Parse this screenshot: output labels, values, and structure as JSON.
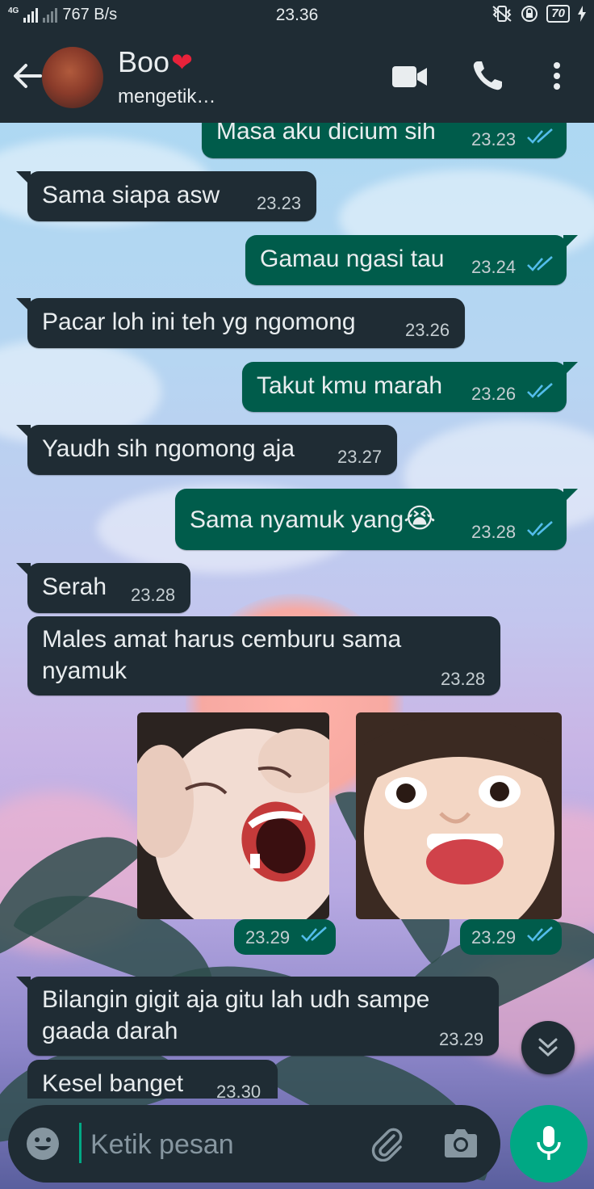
{
  "status_bar": {
    "network": "4G",
    "speed": "767 B/s",
    "time": "23.36",
    "battery": "70"
  },
  "header": {
    "contact_name": "Boo",
    "contact_emoji": "❤",
    "status": "mengetik…"
  },
  "messages": [
    {
      "dir": "out",
      "text": "Masa aku dicium sih",
      "time": "23.23",
      "ticks": "read"
    },
    {
      "dir": "in",
      "text": "Sama siapa asw",
      "time": "23.23"
    },
    {
      "dir": "out",
      "text": "Gamau ngasi tau",
      "time": "23.24",
      "ticks": "read"
    },
    {
      "dir": "in",
      "text": "Pacar loh ini teh yg ngomong",
      "time": "23.26"
    },
    {
      "dir": "out",
      "text": "Takut kmu marah",
      "time": "23.26",
      "ticks": "read"
    },
    {
      "dir": "in",
      "text": "Yaudh sih ngomong aja",
      "time": "23.27"
    },
    {
      "dir": "out",
      "text": "Sama nyamuk yang",
      "emoji": "😭",
      "time": "23.28",
      "ticks": "read"
    },
    {
      "dir": "in",
      "text": "Serah",
      "time": "23.28"
    },
    {
      "dir": "in",
      "text_line1": "Males amat harus cemburu sama",
      "text_line2": "nyamuk",
      "time": "23.28"
    },
    {
      "dir": "out",
      "type": "sticker",
      "time": "23.29",
      "ticks": "read"
    },
    {
      "dir": "out",
      "type": "sticker",
      "time": "23.29",
      "ticks": "read"
    },
    {
      "dir": "in",
      "text_line1": "Bilangin gigit aja gitu lah udh sampe",
      "text_line2": "gaada darah",
      "time": "23.29"
    },
    {
      "dir": "in",
      "text": "Kesel banget",
      "time": "23.30"
    }
  ],
  "composer": {
    "placeholder": "Ketik pesan"
  },
  "colors": {
    "header_bg": "#1f2c34",
    "incoming_bubble": "#1f2c34",
    "outgoing_bubble": "#005c4b",
    "read_ticks": "#53bdeb",
    "accent": "#00a884"
  },
  "icons": {
    "back": "arrow-left-icon",
    "video": "video-call-icon",
    "call": "phone-icon",
    "menu": "more-vertical-icon",
    "emoji": "emoji-icon",
    "attach": "paperclip-icon",
    "camera": "camera-icon",
    "mic": "microphone-icon",
    "scroll": "double-chevron-down-icon"
  }
}
